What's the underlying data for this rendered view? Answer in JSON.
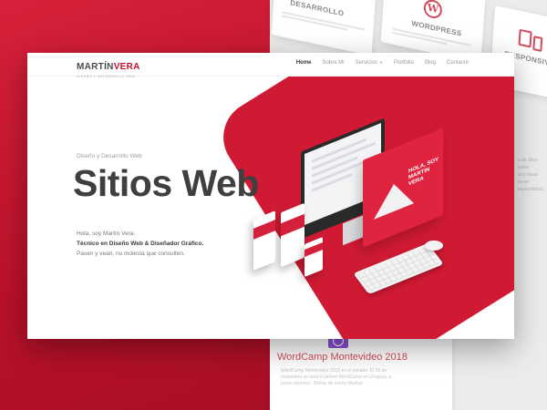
{
  "background": {
    "card_desarrollo": {
      "title": "DESARROLLO"
    },
    "card_wordpress": {
      "title": "WORDPRESS",
      "icon": "wordpress-icon"
    },
    "card_responsive": {
      "title": "RESPONSIVE",
      "icon": "mobile-devices-icon"
    },
    "side_text_lines": [
      "s de años como",
      "al y visual",
      "co en",
      "especialidad"
    ],
    "event_card": {
      "title": "WordCamp Montevideo 2018",
      "lines": [
        "WordCamp Montevideo 2018 en el pasado. El 26 de",
        "noviembre se hará el primer WordCamp en Uruguay, a",
        "punto alumnos. Detrás de varios Meetup"
      ]
    }
  },
  "nav": {
    "logo_first": "MARTÍN",
    "logo_second": "VERA",
    "logo_tagline": "DISEÑO Y DESARROLLO WEB",
    "menu": [
      {
        "label": "Home",
        "active": true
      },
      {
        "label": "Sobre Mi"
      },
      {
        "label": "Servicios"
      },
      {
        "label": "Portfolio"
      },
      {
        "label": "Blog"
      },
      {
        "label": "Contacto"
      }
    ]
  },
  "hero": {
    "kicker": "Diseño y Desarrollo Web",
    "headline": "Sitios Web",
    "greeting": "Hola, soy Martín Vera.",
    "role": "Técnico en Diseño Web & Diseñador Gráfico.",
    "invite": "Pasen y vean, no molesta que consulten."
  },
  "illustration": {
    "panel_text": "HOLA, SOY MARTIN VERA"
  },
  "colors": {
    "accent": "#c41230",
    "text_dark": "#3f3f3f"
  }
}
